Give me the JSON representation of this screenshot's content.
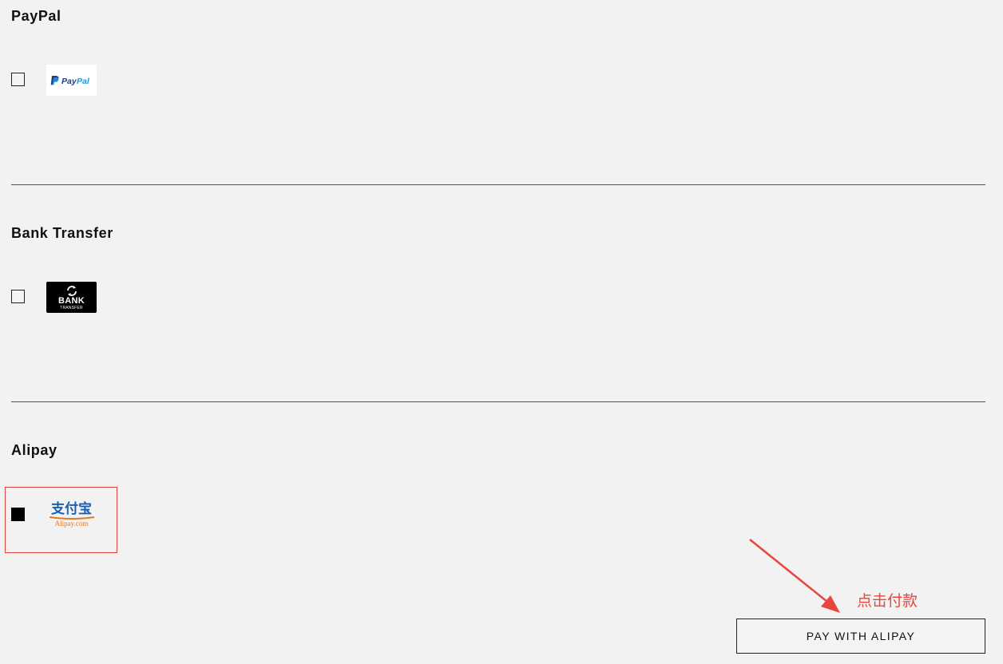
{
  "payment_methods": [
    {
      "title": "PayPal",
      "logo_text": "PayPal",
      "selected": false
    },
    {
      "title": "Bank Transfer",
      "logo_text": "BANK",
      "logo_subtext": "TRANSFER",
      "selected": false
    },
    {
      "title": "Alipay",
      "logo_text": "支付宝",
      "logo_subtext": "Alipay.com",
      "selected": true
    }
  ],
  "annotation": {
    "text": "点击付款",
    "color": "#e8453c"
  },
  "pay_button": {
    "label": "PAY WITH ALIPAY"
  },
  "colors": {
    "background": "#f2f2f2",
    "highlight": "#e0403a",
    "paypal_dark": "#253b80",
    "paypal_light": "#179bd7",
    "alipay_blue": "#1a5fb4",
    "alipay_orange": "#e87722"
  }
}
